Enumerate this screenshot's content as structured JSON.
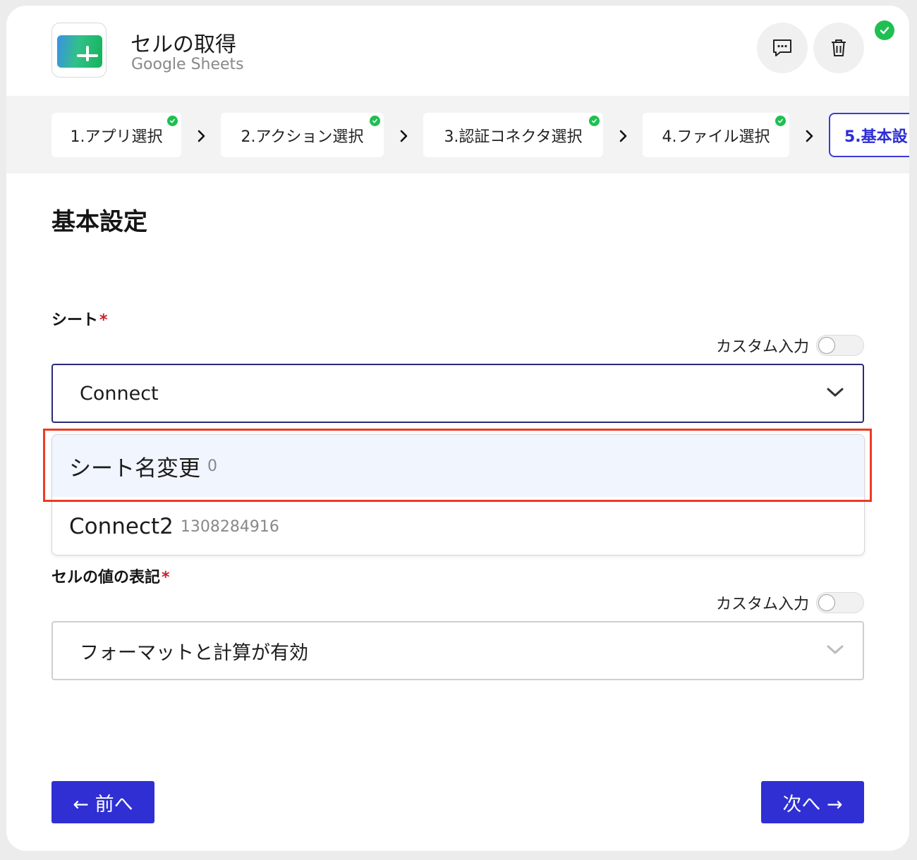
{
  "header": {
    "title": "セルの取得",
    "subtitle": "Google Sheets"
  },
  "steps": [
    {
      "label": "1.アプリ選択",
      "done": true
    },
    {
      "label": "2.アクション選択",
      "done": true
    },
    {
      "label": "3.認証コネクタ選択",
      "done": true
    },
    {
      "label": "4.ファイル選択",
      "done": true
    },
    {
      "label": "5.基本設",
      "done": false,
      "active": true
    }
  ],
  "section": {
    "title": "基本設定"
  },
  "sheet_field": {
    "label": "シート",
    "required_mark": "*",
    "custom_input_label": "カスタム入力",
    "value": "Connect",
    "options": [
      {
        "name": "シート名変更",
        "id": "0"
      },
      {
        "name": "Connect2",
        "id": "1308284916"
      }
    ]
  },
  "cell_value_field": {
    "label": "セルの値の表記",
    "required_mark": "*",
    "custom_input_label": "カスタム入力",
    "value": "フォーマットと計算が有効"
  },
  "nav": {
    "prev_label": "← 前へ",
    "next_label": "次へ →"
  },
  "colors": {
    "accent": "#2f2fd4",
    "success": "#1fbf52",
    "highlight": "#ee3a24"
  }
}
